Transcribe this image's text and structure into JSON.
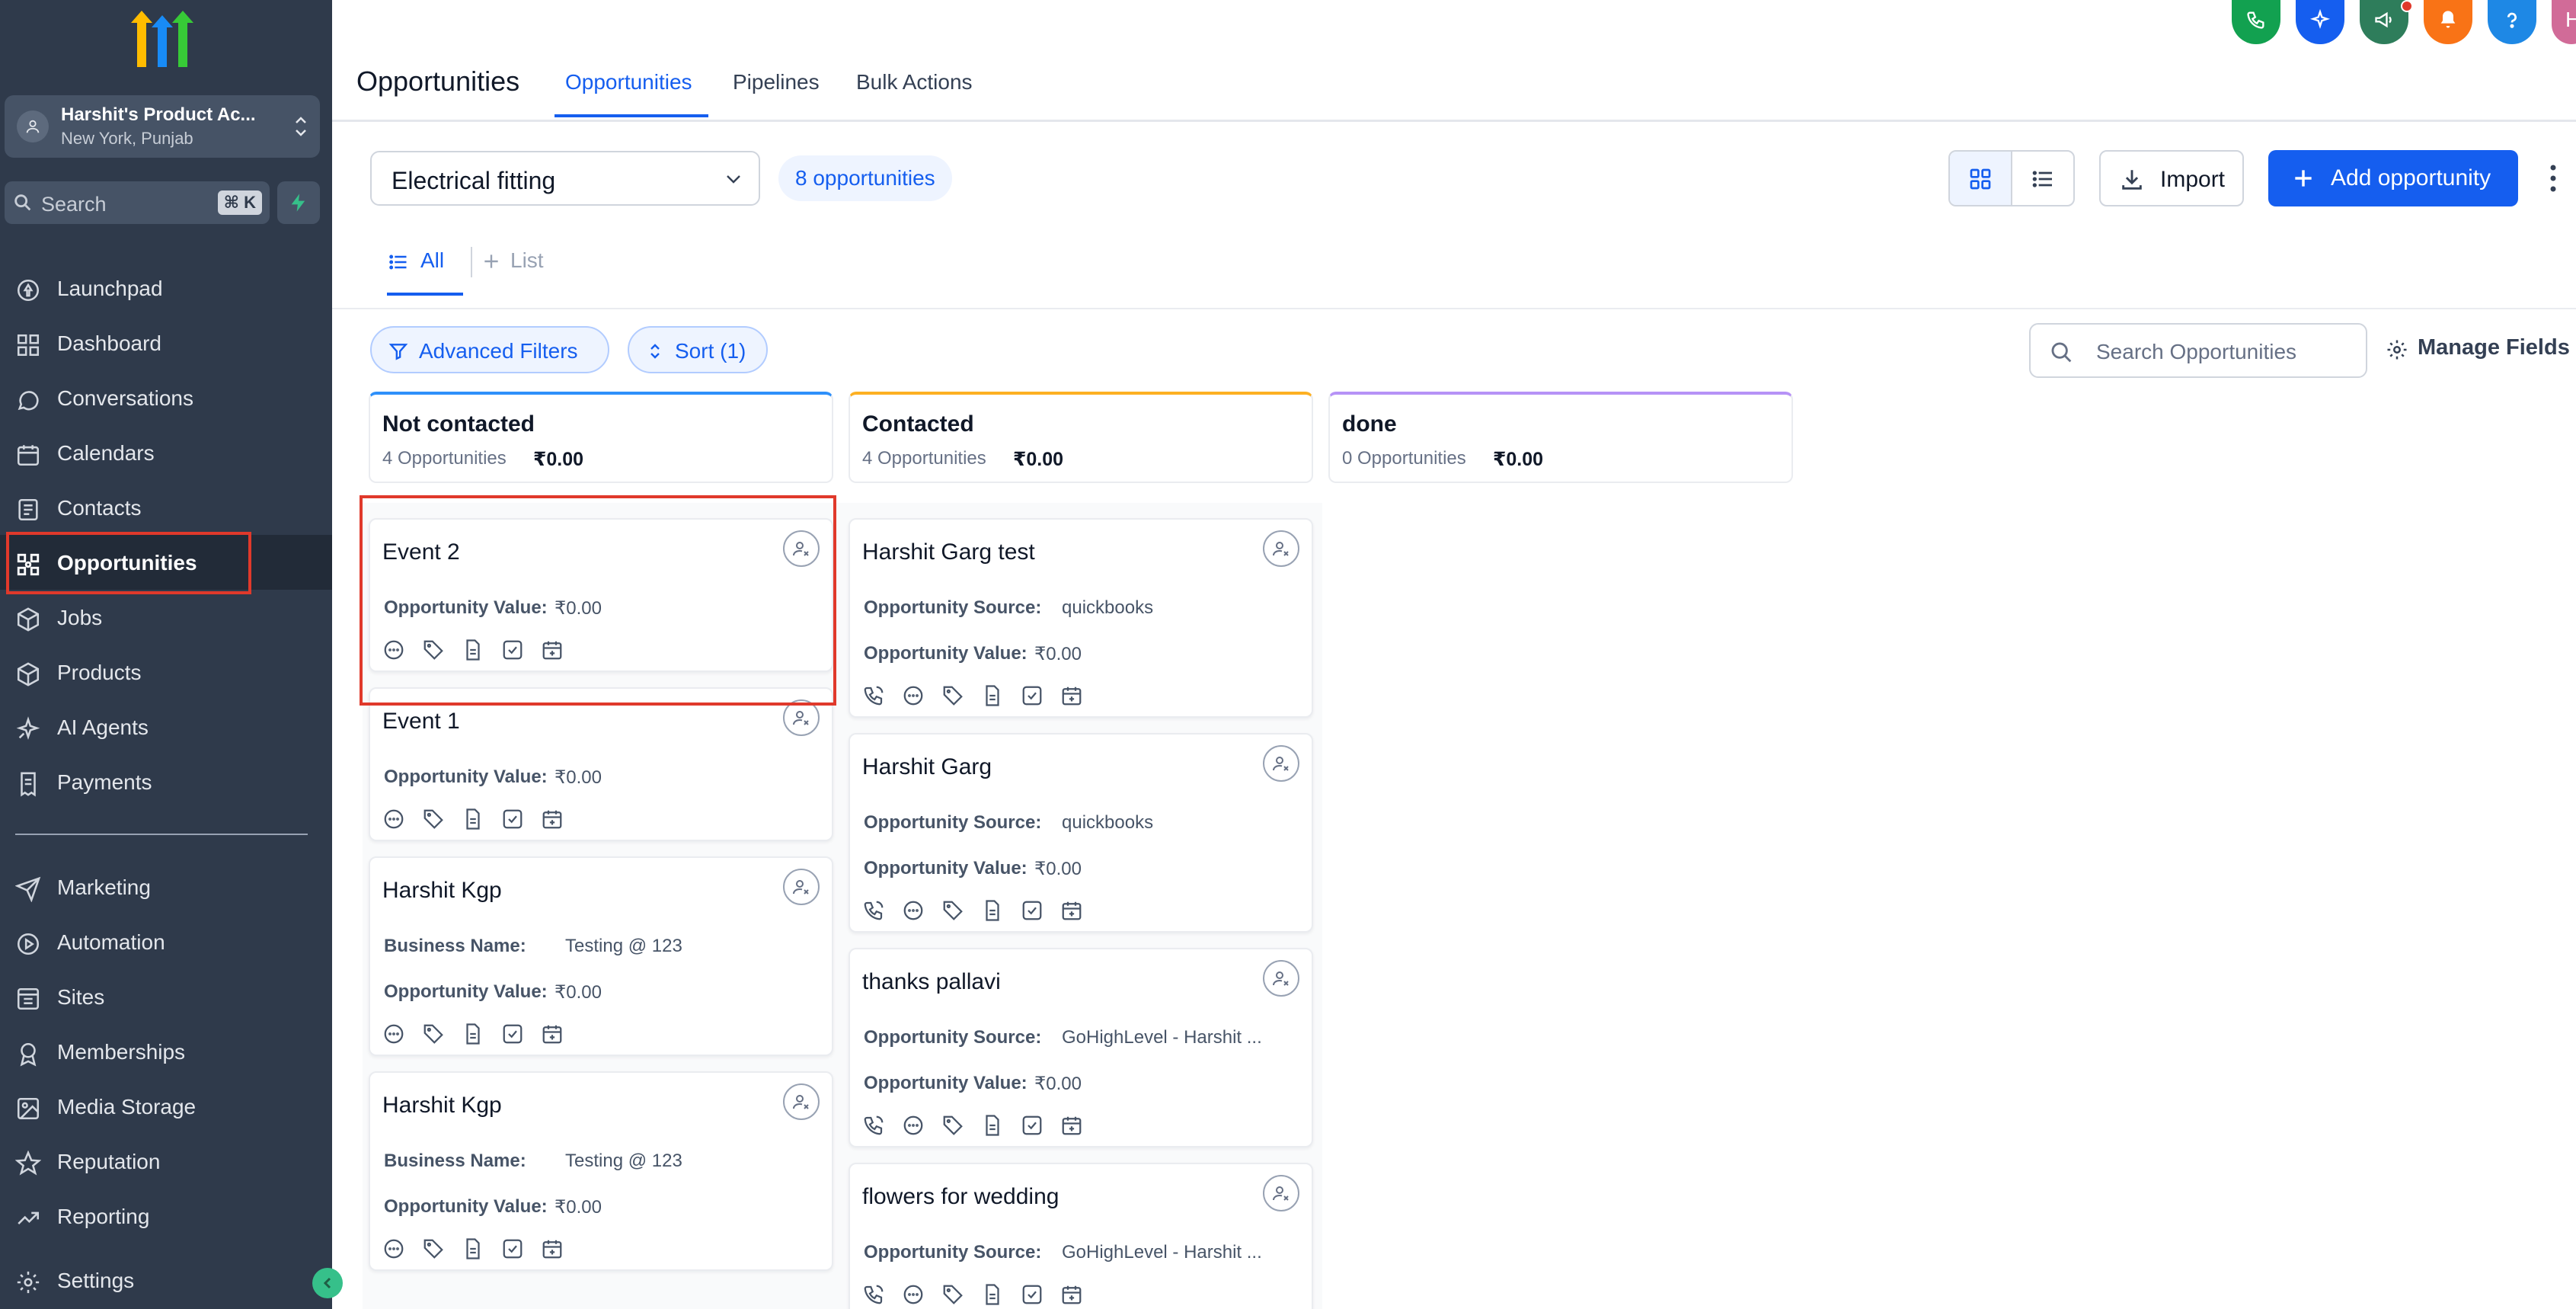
{
  "sidebar": {
    "account": {
      "name": "Harshit's Product Ac...",
      "location": "New York, Punjab"
    },
    "search": {
      "placeholder": "Search",
      "shortcut": "⌘ K"
    },
    "items": [
      {
        "label": "Launchpad",
        "icon": "rocket-icon"
      },
      {
        "label": "Dashboard",
        "icon": "grid-icon"
      },
      {
        "label": "Conversations",
        "icon": "chat-icon"
      },
      {
        "label": "Calendars",
        "icon": "calendar-icon"
      },
      {
        "label": "Contacts",
        "icon": "contacts-icon"
      },
      {
        "label": "Opportunities",
        "icon": "opportunities-icon",
        "active": true
      },
      {
        "label": "Jobs",
        "icon": "box-icon"
      },
      {
        "label": "Products",
        "icon": "cube-icon"
      },
      {
        "label": "AI Agents",
        "icon": "sparkle-icon"
      },
      {
        "label": "Payments",
        "icon": "receipt-icon"
      }
    ],
    "items2": [
      {
        "label": "Marketing",
        "icon": "send-icon"
      },
      {
        "label": "Automation",
        "icon": "automation-icon"
      },
      {
        "label": "Sites",
        "icon": "sites-icon"
      },
      {
        "label": "Memberships",
        "icon": "award-icon"
      },
      {
        "label": "Media Storage",
        "icon": "image-icon"
      },
      {
        "label": "Reputation",
        "icon": "star-icon"
      },
      {
        "label": "Reporting",
        "icon": "trend-icon"
      }
    ],
    "settings_label": "Settings"
  },
  "header": {
    "title": "Opportunities",
    "tabs": [
      {
        "label": "Opportunities",
        "active": true
      },
      {
        "label": "Pipelines"
      },
      {
        "label": "Bulk Actions"
      }
    ],
    "avatar_initial": "H"
  },
  "toolbar": {
    "pipeline": "Electrical fitting",
    "count": "8 opportunities",
    "import_label": "Import",
    "add_label": "Add opportunity"
  },
  "subtabs": {
    "all": "All",
    "list": "List"
  },
  "filters": {
    "advanced": "Advanced Filters",
    "sort": "Sort (1)",
    "search_placeholder": "Search Opportunities",
    "manage_fields": "Manage Fields"
  },
  "columns": [
    {
      "title": "Not contacted",
      "count": "4 Opportunities",
      "amount": "₹0.00",
      "color": "#2e90fa",
      "cards": [
        {
          "title": "Event 2",
          "fields": [
            {
              "label": "Opportunity Value:",
              "value": "₹0.00"
            }
          ]
        },
        {
          "title": "Event 1",
          "fields": [
            {
              "label": "Opportunity Value:",
              "value": "₹0.00"
            }
          ]
        },
        {
          "title": "Harshit Kgp",
          "fields": [
            {
              "label": "Business Name:",
              "value": "Testing @ 123"
            },
            {
              "label": "Opportunity Value:",
              "value": "₹0.00"
            }
          ]
        },
        {
          "title": "Harshit Kgp",
          "fields": [
            {
              "label": "Business Name:",
              "value": "Testing @ 123"
            },
            {
              "label": "Opportunity Value:",
              "value": "₹0.00"
            }
          ]
        }
      ]
    },
    {
      "title": "Contacted",
      "count": "4 Opportunities",
      "amount": "₹0.00",
      "color": "#fdb022",
      "cards": [
        {
          "title": "Harshit Garg test",
          "fields": [
            {
              "label": "Opportunity Source:",
              "value": "quickbooks"
            },
            {
              "label": "Opportunity Value:",
              "value": "₹0.00"
            }
          ]
        },
        {
          "title": "Harshit Garg",
          "fields": [
            {
              "label": "Opportunity Source:",
              "value": "quickbooks"
            },
            {
              "label": "Opportunity Value:",
              "value": "₹0.00"
            }
          ]
        },
        {
          "title": "thanks pallavi",
          "fields": [
            {
              "label": "Opportunity Source:",
              "value": "GoHighLevel - Harshit ..."
            },
            {
              "label": "Opportunity Value:",
              "value": "₹0.00"
            }
          ]
        },
        {
          "title": "flowers for wedding",
          "fields": [
            {
              "label": "Opportunity Source:",
              "value": "GoHighLevel - Harshit ..."
            }
          ]
        }
      ]
    },
    {
      "title": "done",
      "count": "0 Opportunities",
      "amount": "₹0.00",
      "color": "#b692f6",
      "cards": []
    }
  ]
}
